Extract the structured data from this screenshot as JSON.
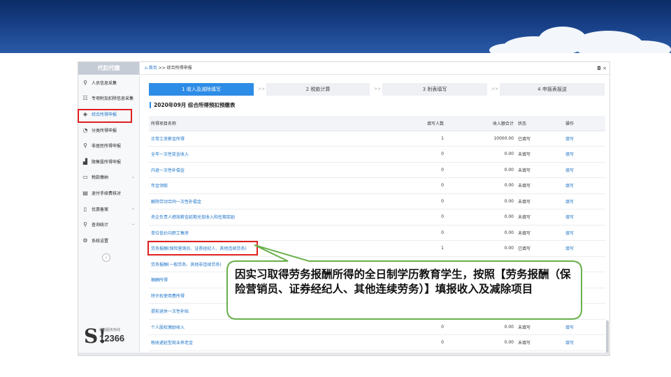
{
  "sidebar": {
    "title": "代扣代缴",
    "items": [
      {
        "label": "人员信息采集",
        "icon": "person-icon",
        "glyph": "⚲"
      },
      {
        "label": "专项附加扣除信息采集",
        "icon": "list-icon",
        "glyph": "☷"
      },
      {
        "label": "综合所得申报",
        "icon": "layers-icon",
        "glyph": "◈"
      },
      {
        "label": "分类所得申报",
        "icon": "pie-icon",
        "glyph": "◔"
      },
      {
        "label": "非居民所得申报",
        "icon": "person-icon",
        "glyph": "⚲"
      },
      {
        "label": "限售股所得申报",
        "icon": "bar-chart-icon",
        "glyph": "▟"
      },
      {
        "label": "税款缴纳",
        "icon": "folder-icon",
        "glyph": "▭"
      },
      {
        "label": "退付手续费核对",
        "icon": "document-icon",
        "glyph": "▤"
      },
      {
        "label": "优惠备案",
        "icon": "file-icon",
        "glyph": "▯"
      },
      {
        "label": "查询统计",
        "icon": "user-search-icon",
        "glyph": "⚲"
      },
      {
        "label": "系统设置",
        "icon": "gear-icon",
        "glyph": "⚙"
      }
    ],
    "collapse_glyph": "‹",
    "hotline": {
      "label": "纳税服务热线",
      "number": "12366",
      "glyph": "S!"
    }
  },
  "topbar": {
    "home": "首页",
    "separator": ">>",
    "page": "综合所得申报",
    "controls": "◘ ×"
  },
  "steps": [
    {
      "label": "1 收入及减除填写",
      "active": true
    },
    {
      "label": "2 税款计算",
      "active": false
    },
    {
      "label": "3 附表填写",
      "active": false
    },
    {
      "label": "4 申报表报送",
      "active": false
    }
  ],
  "step_separator": ">>",
  "table": {
    "title": "2020年09月 综合所得预扣预缴表",
    "columns": [
      "所得项目名称",
      "填写人数",
      "收入额合计",
      "状态",
      "操作"
    ],
    "rows": [
      {
        "name": "正常工资薪金所得",
        "count": "1",
        "amount": "10000.00",
        "status": "已填写",
        "done": true,
        "op": "填写"
      },
      {
        "name": "全年一次性奖金收入",
        "count": "0",
        "amount": "0.00",
        "status": "未填写",
        "done": false,
        "op": "填写"
      },
      {
        "name": "内退一次性补偿金",
        "count": "0",
        "amount": "0.00",
        "status": "未填写",
        "done": false,
        "op": "填写"
      },
      {
        "name": "年金领取",
        "count": "0",
        "amount": "0.00",
        "status": "未填写",
        "done": false,
        "op": "填写"
      },
      {
        "name": "解除劳动合同一次性补偿金",
        "count": "0",
        "amount": "0.00",
        "status": "未填写",
        "done": false,
        "op": "填写"
      },
      {
        "name": "央企负责人绩效薪金延期兑现收入和任期奖励",
        "count": "0",
        "amount": "0.00",
        "status": "未填写",
        "done": false,
        "op": "填写"
      },
      {
        "name": "单位低价向职工售房",
        "count": "0",
        "amount": "0.00",
        "status": "未填写",
        "done": false,
        "op": "填写"
      },
      {
        "name": "劳务报酬(保险营销员、证券经纪人、其他连续劳务)",
        "count": "1",
        "amount": "0.00",
        "status": "已填写",
        "done": true,
        "op": "填写"
      },
      {
        "name": "劳务报酬(一般劳务、其他非连续劳务)",
        "count": "",
        "amount": "",
        "status": "",
        "done": false,
        "op": ""
      },
      {
        "name": "稿酬所得",
        "count": "",
        "amount": "",
        "status": "",
        "done": false,
        "op": ""
      },
      {
        "name": "特许权使用费所得",
        "count": "",
        "amount": "",
        "status": "",
        "done": false,
        "op": ""
      },
      {
        "name": "提前退休一次性补贴",
        "count": "",
        "amount": "",
        "status": "",
        "done": false,
        "op": ""
      },
      {
        "name": "个人股权激励收入",
        "count": "0",
        "amount": "0.00",
        "status": "未填写",
        "done": false,
        "op": "填写"
      },
      {
        "name": "税收递延型商业养老金",
        "count": "0",
        "amount": "0.00",
        "status": "未填写",
        "done": false,
        "op": "填写"
      }
    ]
  },
  "callout": {
    "text": "因实习取得劳务报酬所得的全日制学历教育学生，按照【劳务报酬（保险营销员、证券经纪人、其他连续劳务）】填报收入及减除项目"
  },
  "colors": {
    "accent": "#2d8ce6",
    "link": "#1d74c9",
    "done": "#1aa34a",
    "todo": "#e8483b",
    "highlight": "#e02020",
    "callout_border": "#6ab04c"
  }
}
